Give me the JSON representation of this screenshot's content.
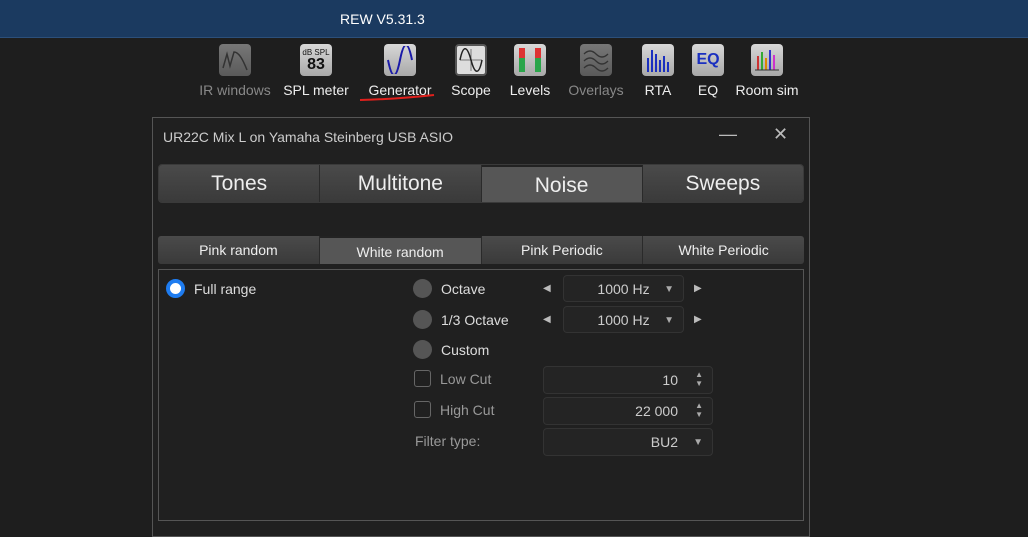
{
  "app": {
    "title": "REW V5.31.3"
  },
  "toolbar": [
    {
      "label": "IR windows",
      "icon": "ir-windows-icon",
      "enabled": false
    },
    {
      "label": "SPL meter",
      "icon": "spl-meter-icon",
      "enabled": true,
      "icon_text_top": "dB SPL",
      "icon_text_value": "83"
    },
    {
      "label": "Generator",
      "icon": "generator-icon",
      "enabled": true
    },
    {
      "label": "Scope",
      "icon": "scope-icon",
      "enabled": true
    },
    {
      "label": "Levels",
      "icon": "levels-icon",
      "enabled": true
    },
    {
      "label": "Overlays",
      "icon": "overlays-icon",
      "enabled": false
    },
    {
      "label": "RTA",
      "icon": "rta-icon",
      "enabled": true
    },
    {
      "label": "EQ",
      "icon": "eq-icon",
      "enabled": true,
      "icon_text": "EQ"
    },
    {
      "label": "Room sim",
      "icon": "room-sim-icon",
      "enabled": true
    }
  ],
  "annotation_color": "#e0201c",
  "dialog": {
    "title": "UR22C Mix L on Yamaha Steinberg USB ASIO",
    "minimize": "—",
    "close": "✕",
    "tabs": [
      "Tones",
      "Multitone",
      "Noise",
      "Sweeps"
    ],
    "active_tab": "Noise",
    "subtabs": [
      "Pink random",
      "White random",
      "Pink Periodic",
      "White Periodic"
    ],
    "active_subtab": "White random",
    "full_range": "Full range",
    "octave": {
      "label": "Octave",
      "value": "1000 Hz"
    },
    "third_octave": {
      "label": "1/3 Octave",
      "value": "1000 Hz"
    },
    "custom": "Custom",
    "low_cut": {
      "label": "Low Cut",
      "value": "10",
      "checked": false
    },
    "high_cut": {
      "label": "High Cut",
      "value": "22 000",
      "checked": false
    },
    "filter_type": {
      "label": "Filter type:",
      "value": "BU2"
    },
    "selected_range": "Full range",
    "accent": "#1e7cf0"
  }
}
